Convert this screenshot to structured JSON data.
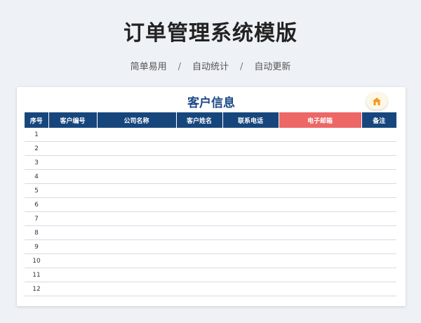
{
  "page": {
    "title": "订单管理系统模版",
    "taglines": [
      "简单易用",
      "自动统计",
      "自动更新"
    ],
    "separator": "/"
  },
  "card": {
    "title": "客户信息",
    "home_icon": "house-icon",
    "accent_colors": {
      "header": "#17467d",
      "email_header": "#ec6766",
      "home": "#f39a1c"
    }
  },
  "table": {
    "headers": [
      "序号",
      "客户编号",
      "公司名称",
      "客户姓名",
      "联系电话",
      "电子邮箱",
      "备注"
    ],
    "rows": [
      "1",
      "2",
      "3",
      "4",
      "5",
      "6",
      "7",
      "8",
      "9",
      "10",
      "11",
      "12"
    ]
  }
}
